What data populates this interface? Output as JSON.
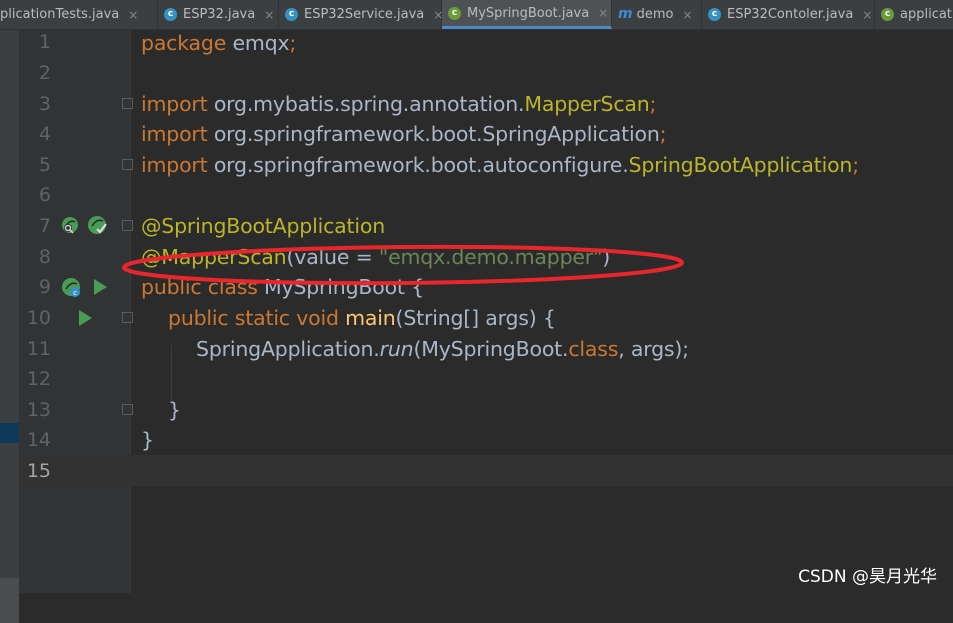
{
  "tabs": [
    {
      "label": "plicationTests.java",
      "icon": "none",
      "active": false
    },
    {
      "label": "ESP32.java",
      "icon": "class-icon",
      "active": false
    },
    {
      "label": "ESP32Service.java",
      "icon": "class-icon",
      "active": false
    },
    {
      "label": "MySpringBoot.java",
      "icon": "spring-boot-class-icon",
      "active": true
    },
    {
      "label": "demo",
      "icon": "maven-icon",
      "active": false
    },
    {
      "label": "ESP32Contoler.java",
      "icon": "class-icon",
      "active": false
    },
    {
      "label": "applicat",
      "icon": "spring-boot-class-icon",
      "active": false
    }
  ],
  "tab_close": "×",
  "line_numbers": [
    "1",
    "2",
    "3",
    "4",
    "5",
    "6",
    "7",
    "8",
    "9",
    "10",
    "11",
    "12",
    "13",
    "14",
    "15"
  ],
  "code": {
    "l1": {
      "kw": "package",
      "rest": " emqx",
      "semi": ";"
    },
    "l3": {
      "kw": "import",
      "path": " org.mybatis.spring.annotation.",
      "cls": "MapperScan",
      "semi": ";"
    },
    "l4": {
      "kw": "import",
      "path": " org.springframework.boot.SpringApplication",
      "semi": ";"
    },
    "l5": {
      "kw": "import",
      "path": " org.springframework.boot.autoconfigure.",
      "cls": "SpringBootApplication",
      "semi": ";"
    },
    "l7": {
      "ann": "@SpringBootApplication"
    },
    "l8": {
      "ann": "@MapperScan",
      "open": "(value = ",
      "str": "\"emqx.demo.mapper\"",
      "close": ")"
    },
    "l9": {
      "kw": "public class",
      "name": " MySpringBoot {"
    },
    "l10": {
      "kw": "public static void",
      "fn": " main",
      "args": "(String[] args) {"
    },
    "l11": {
      "cls": "SpringApplication.",
      "call": "run",
      "open": "(MySpringBoot.",
      "kw": "class",
      "rest": ", args);"
    },
    "l13": {
      "brace": "}"
    },
    "l14": {
      "brace": "}"
    }
  },
  "watermark": "CSDN @昊月光华",
  "colors": {
    "keyword": "#cc7832",
    "annotation": "#bbb529",
    "string": "#6a8759",
    "text": "#a9b7c6",
    "highlight_ellipse": "#e8262b",
    "run_icon": "#499c54"
  }
}
